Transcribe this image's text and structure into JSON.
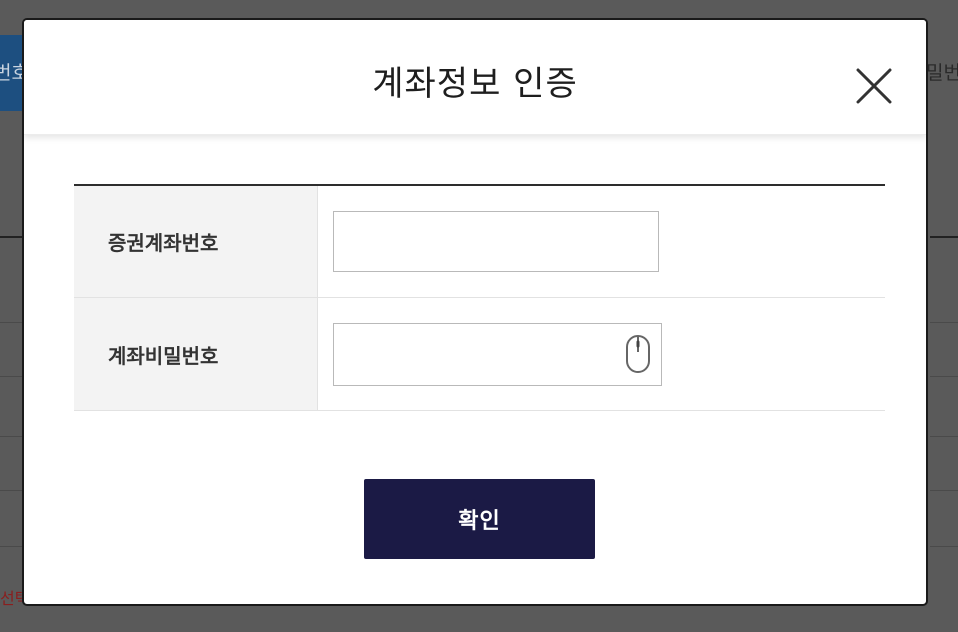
{
  "background": {
    "left_tab_text": "번호",
    "right_text": "밀번",
    "bottom_left_text": "선택"
  },
  "modal": {
    "title": "계좌정보 인증",
    "close_icon": "close-icon",
    "fields": [
      {
        "label": "증권계좌번호",
        "value": "",
        "placeholder": ""
      },
      {
        "label": "계좌비밀번호",
        "value": "",
        "placeholder": "",
        "icon": "mouse-icon"
      }
    ],
    "confirm_label": "확인"
  },
  "colors": {
    "confirm_button": "#1b1a45",
    "label_background": "#f3f3f3",
    "overlay": "#565656"
  }
}
